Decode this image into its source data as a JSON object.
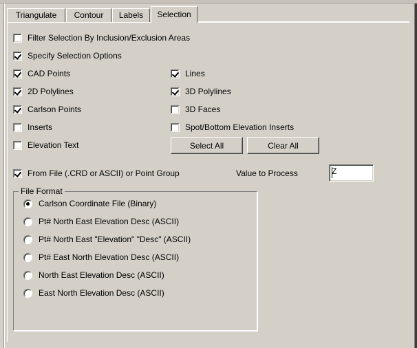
{
  "window": {
    "background_color": "#d4d0c8"
  },
  "tabs": [
    {
      "label": "Triangulate",
      "active": false
    },
    {
      "label": "Contour",
      "active": false
    },
    {
      "label": "Labels",
      "active": false
    },
    {
      "label": "Selection",
      "active": true
    }
  ],
  "selection_page": {
    "checkboxes_left": [
      {
        "label": "Filter Selection By Inclusion/Exclusion Areas",
        "checked": false
      },
      {
        "label": "Specify Selection Options",
        "checked": true
      },
      {
        "label": "CAD Points",
        "checked": true
      },
      {
        "label": "2D Polylines",
        "checked": true
      },
      {
        "label": "Carlson Points",
        "checked": true
      },
      {
        "label": "Inserts",
        "checked": false
      },
      {
        "label": "Elevation Text",
        "checked": false
      }
    ],
    "checkboxes_right": [
      {
        "label": "Lines",
        "checked": true
      },
      {
        "label": "3D Polylines",
        "checked": true
      },
      {
        "label": "3D Faces",
        "checked": false
      },
      {
        "label": "Spot/Bottom Elevation Inserts",
        "checked": false
      }
    ],
    "buttons": {
      "select_all": "Select All",
      "clear_all": "Clear All"
    },
    "from_file": {
      "label": "From File (.CRD or ASCII) or Point Group",
      "checked": true
    },
    "value_to_process": {
      "label": "Value to Process",
      "value": "Z",
      "placeholder": ""
    },
    "file_format": {
      "title": "File Format",
      "options": [
        {
          "label": "Carlson Coordinate File (Binary)",
          "selected": true
        },
        {
          "label": "Pt# North East Elevation Desc (ASCII)",
          "selected": false
        },
        {
          "label": "Pt# North East \"Elevation\" \"Desc\" (ASCII)",
          "selected": false
        },
        {
          "label": "Pt# East North Elevation Desc (ASCII)",
          "selected": false
        },
        {
          "label": "North East Elevation Desc (ASCII)",
          "selected": false
        },
        {
          "label": "East North Elevation Desc (ASCII)",
          "selected": false
        }
      ]
    }
  }
}
